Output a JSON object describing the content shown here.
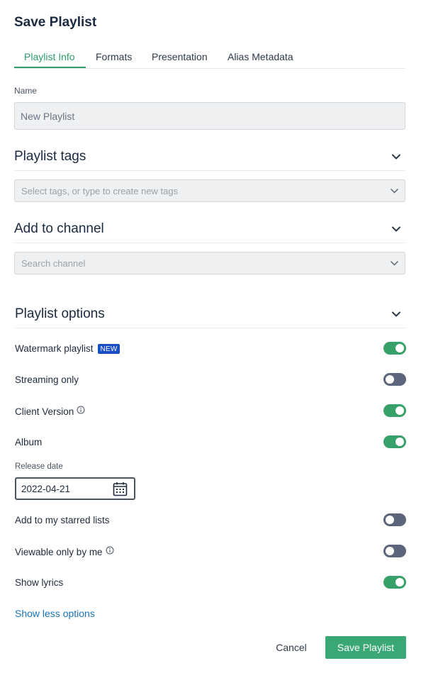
{
  "dialog": {
    "title": "Save Playlist"
  },
  "tabs": [
    {
      "label": "Playlist Info",
      "active": true
    },
    {
      "label": "Formats",
      "active": false
    },
    {
      "label": "Presentation",
      "active": false
    },
    {
      "label": "Alias Metadata",
      "active": false
    }
  ],
  "name_field": {
    "label": "Name",
    "value": "New Playlist"
  },
  "playlist_tags": {
    "title": "Playlist tags",
    "placeholder": "Select tags, or type to create new tags",
    "chevron_icon": "chevron-down-icon"
  },
  "add_to_channel": {
    "title": "Add to channel",
    "placeholder": "Search channel",
    "chevron_icon": "chevron-down-icon"
  },
  "playlist_options": {
    "title": "Playlist options",
    "items": [
      {
        "label": "Watermark playlist",
        "badge": "NEW",
        "enabled": true
      },
      {
        "label": "Streaming only",
        "enabled": false
      },
      {
        "label": "Client Version",
        "info_icon": "info-icon",
        "enabled": true
      },
      {
        "label": "Album",
        "enabled": true
      },
      {
        "label": "Add to my starred lists",
        "enabled": false
      },
      {
        "label": "Viewable only by me",
        "info_icon": "info-icon",
        "enabled": false
      },
      {
        "label": "Show lyrics",
        "enabled": true
      }
    ],
    "release_date": {
      "label": "Release date",
      "value": "2022-04-21",
      "icon": "calendar-icon"
    },
    "toggle_link": "Show less options"
  },
  "footer": {
    "cancel_label": "Cancel",
    "save_label": "Save Playlist"
  },
  "colors": {
    "accent": "#2e9e6b",
    "toggle_on": "#38a169",
    "toggle_off": "#5c6579",
    "badge": "#1a4fc7",
    "link": "#1a73b7",
    "primary_button": "#3aa874"
  }
}
